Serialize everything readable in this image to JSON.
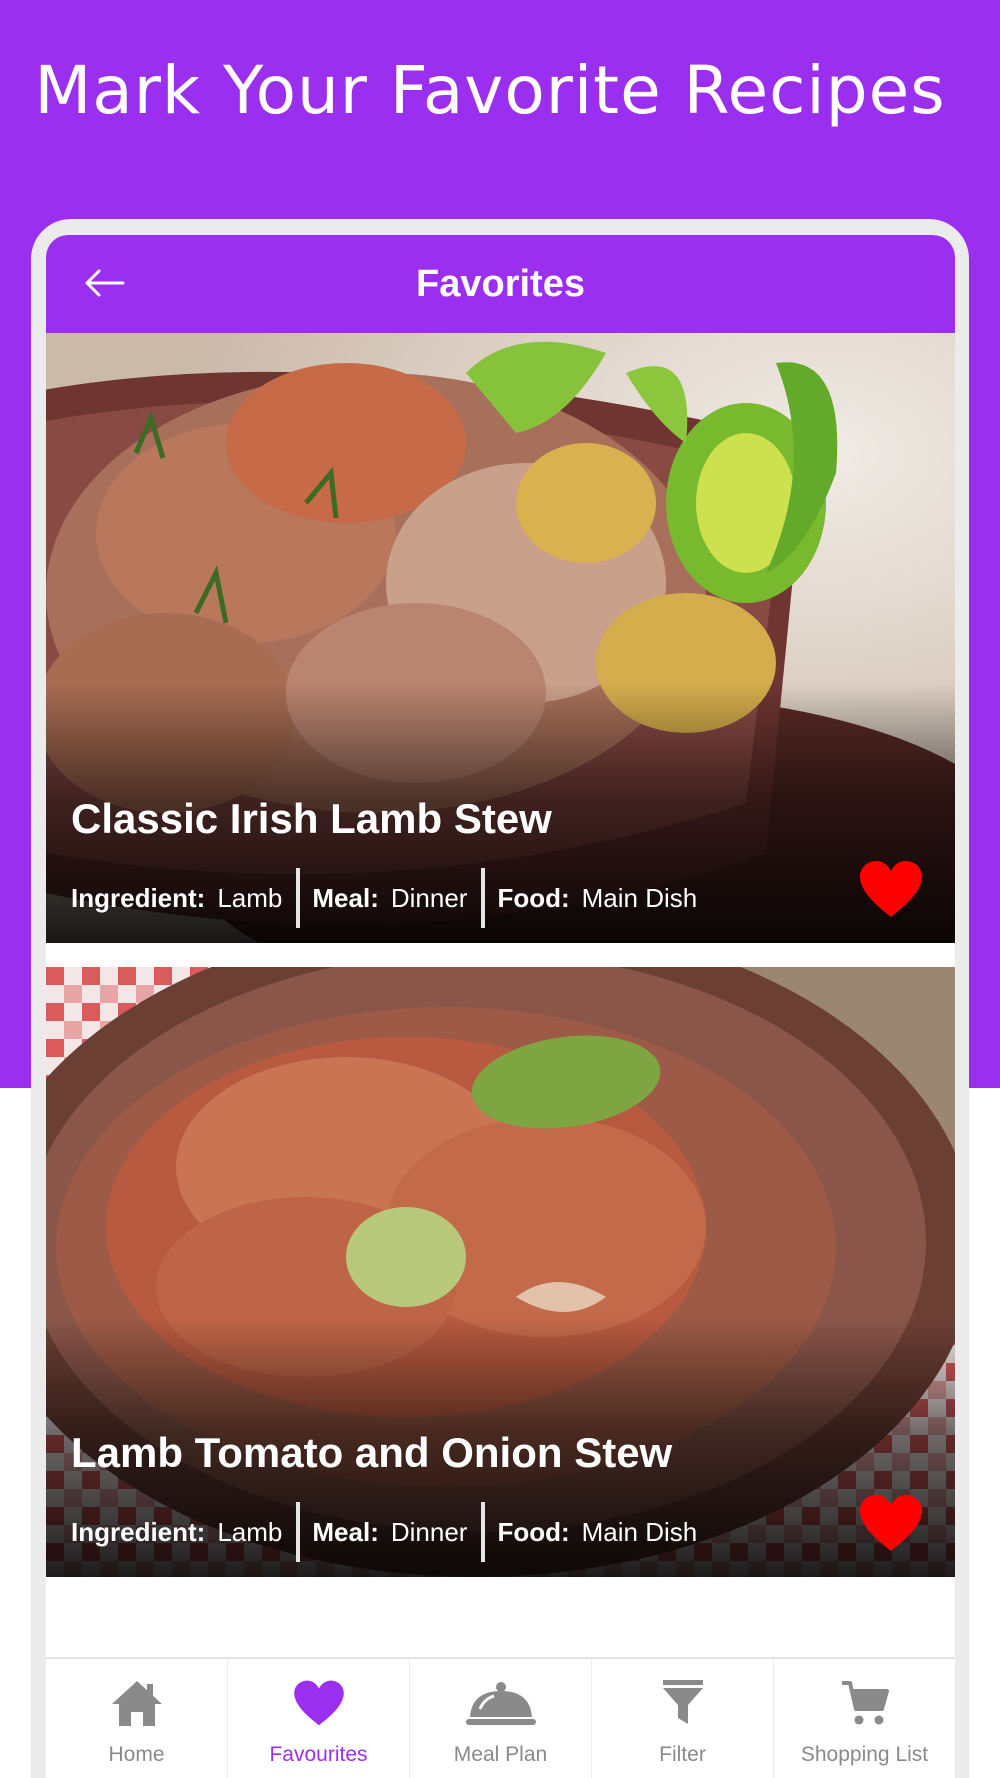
{
  "headline": "Mark Your Favorite Recipes",
  "appbar": {
    "title": "Favorites",
    "back_icon": "arrow-left-icon"
  },
  "colors": {
    "brand": "#9b2ff0",
    "heart": "#ff0000",
    "nav_inactive": "#8a8a8a"
  },
  "recipes": [
    {
      "title": "Classic Irish Lamb Stew",
      "ingredient_label": "Ingredient:",
      "ingredient": "Lamb",
      "meal_label": "Meal:",
      "meal": "Dinner",
      "food_label": "Food:",
      "food": "Main Dish",
      "favorite_icon": "heart-icon"
    },
    {
      "title": "Lamb Tomato and Onion Stew",
      "ingredient_label": "Ingredient:",
      "ingredient": "Lamb",
      "meal_label": "Meal:",
      "meal": "Dinner",
      "food_label": "Food:",
      "food": "Main Dish",
      "favorite_icon": "heart-icon"
    }
  ],
  "nav": [
    {
      "label": "Home",
      "icon": "home-icon",
      "active": false
    },
    {
      "label": "Favourites",
      "icon": "heart-icon",
      "active": true
    },
    {
      "label": "Meal Plan",
      "icon": "cloche-icon",
      "active": false
    },
    {
      "label": "Filter",
      "icon": "filter-icon",
      "active": false
    },
    {
      "label": "Shopping List",
      "icon": "cart-icon",
      "active": false
    }
  ]
}
